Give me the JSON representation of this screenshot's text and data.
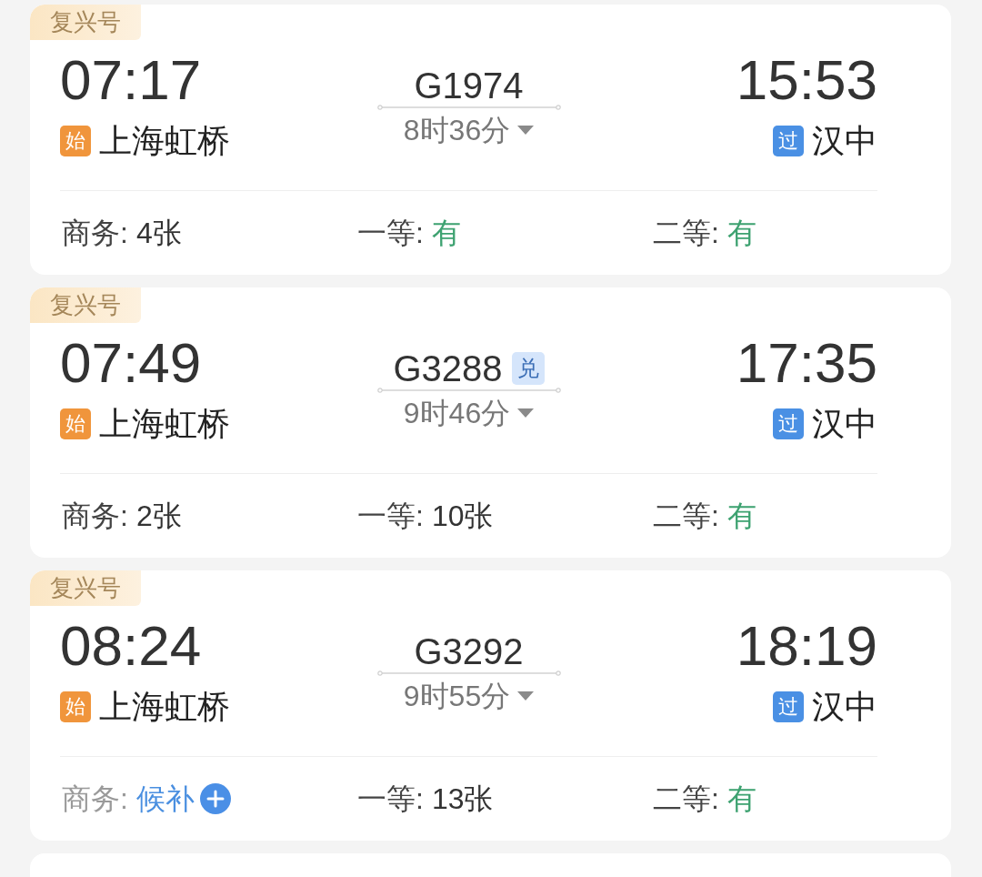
{
  "trains": [
    {
      "brand": "复兴号",
      "depart_time": "07:17",
      "origin": {
        "kind": "start",
        "badge": "始",
        "name": "上海虹桥"
      },
      "train_no": "G1974",
      "duration": "8时36分",
      "stops_expanded": false,
      "arrive_time": "15:53",
      "destination": {
        "kind": "pass",
        "badge": "过",
        "name": "汉中"
      },
      "seats": [
        {
          "kind": "count",
          "label": "商务:",
          "value": "4张"
        },
        {
          "kind": "available",
          "label": "一等:",
          "value": "有"
        },
        {
          "kind": "available",
          "label": "二等:",
          "value": "有"
        }
      ]
    },
    {
      "brand": "复兴号",
      "depart_time": "07:49",
      "origin": {
        "kind": "start",
        "badge": "始",
        "name": "上海虹桥"
      },
      "train_no": "G3288",
      "redeem_tag": "兑",
      "duration": "9时46分",
      "stops_expanded": false,
      "arrive_time": "17:35",
      "destination": {
        "kind": "pass",
        "badge": "过",
        "name": "汉中"
      },
      "seats": [
        {
          "kind": "count",
          "label": "商务:",
          "value": "2张"
        },
        {
          "kind": "count",
          "label": "一等:",
          "value": "10张"
        },
        {
          "kind": "available",
          "label": "二等:",
          "value": "有"
        }
      ]
    },
    {
      "brand": "复兴号",
      "depart_time": "08:24",
      "origin": {
        "kind": "start",
        "badge": "始",
        "name": "上海虹桥"
      },
      "train_no": "G3292",
      "duration": "9时55分",
      "stops_expanded": false,
      "arrive_time": "18:19",
      "destination": {
        "kind": "pass",
        "badge": "过",
        "name": "汉中"
      },
      "seats": [
        {
          "kind": "waitlist",
          "label": "商务:",
          "value": "候补"
        },
        {
          "kind": "count",
          "label": "一等:",
          "value": "13张"
        },
        {
          "kind": "available",
          "label": "二等:",
          "value": "有"
        }
      ]
    }
  ]
}
